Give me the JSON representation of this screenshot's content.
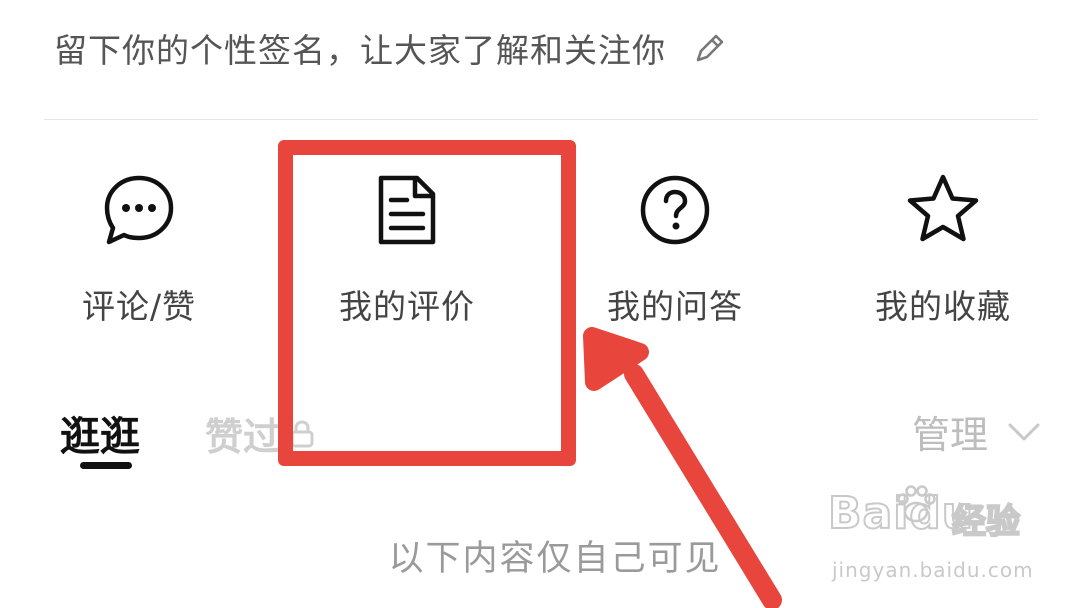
{
  "profile": {
    "signature_prompt": "留下你的个性签名，让大家了解和关注你",
    "edit_icon": "pencil-icon"
  },
  "menu": {
    "items": [
      {
        "label": "评论/赞",
        "icon": "comment-bubble-icon"
      },
      {
        "label": "我的评价",
        "icon": "document-icon"
      },
      {
        "label": "我的问答",
        "icon": "question-circle-icon"
      },
      {
        "label": "我的收藏",
        "icon": "star-icon"
      }
    ]
  },
  "tabs": {
    "active_label": "逛逛",
    "liked_label": "赞过",
    "liked_icon": "lock-icon",
    "manage_label": "管理",
    "manage_icon": "chevron-down-icon"
  },
  "notice": {
    "text": "以下内容仅自己可见"
  },
  "annotation": {
    "color": "#e8453c"
  },
  "watermark": {
    "brand": "Baidu",
    "product": "经验",
    "url": "jingyan.baidu.com"
  }
}
